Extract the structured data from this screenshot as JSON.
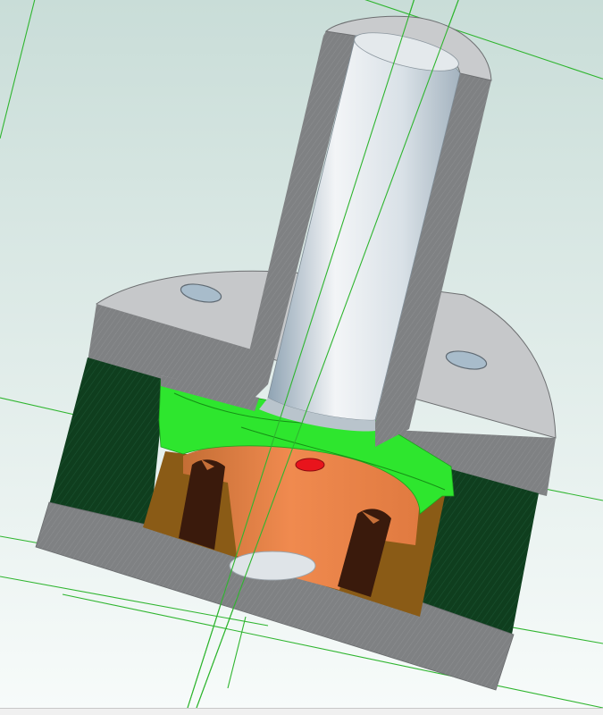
{
  "viewport": {
    "background_top": "#c9ddd8",
    "background_bottom": "#f7fbfa",
    "construction_line_color": "#2fb52f"
  },
  "model": {
    "section_colors": {
      "housing_face": "#808284",
      "housing_top": "#c9cbcd",
      "housing_hatch": "#0e3d1d",
      "bearing_cap": "#2ee62e",
      "gear_body": "#e9834a",
      "gear_shadow": "#b8692e",
      "gear_tooth": "#3a1a0c",
      "cavity_bronze": "#8a5a14",
      "shaft_light": "#f2f4f6",
      "shaft_dark": "#a9b9c4",
      "marker": "#e8141c"
    }
  }
}
